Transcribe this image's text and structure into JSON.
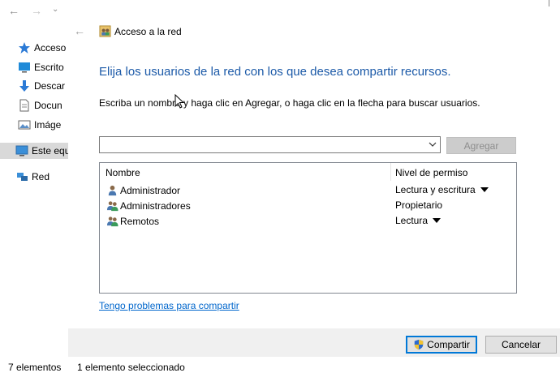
{
  "explorer": {
    "sidebar": [
      {
        "label": "Acceso",
        "icon": "star-icon"
      },
      {
        "label": "Escrito",
        "icon": "desktop-icon"
      },
      {
        "label": "Descar",
        "icon": "download-icon"
      },
      {
        "label": "Docun",
        "icon": "document-icon"
      },
      {
        "label": "Imáge",
        "icon": "pictures-icon"
      },
      {
        "label": "Este equ",
        "icon": "computer-icon"
      },
      {
        "label": "Red",
        "icon": "network-icon"
      }
    ],
    "status": {
      "count": "7 elementos",
      "selected": "1 elemento seleccionado"
    }
  },
  "dialog": {
    "title": "Acceso a la red",
    "heading": "Elija los usuarios de la red con los que desea compartir recursos.",
    "instruction": "Escriba un nombre y haga clic en Agregar, o haga clic en la flecha para buscar usuarios.",
    "user_input": {
      "value": "",
      "placeholder": ""
    },
    "add_label": "Agregar",
    "columns": {
      "name": "Nombre",
      "permission": "Nivel de permiso"
    },
    "rows": [
      {
        "name": "Administrador",
        "permission": "Lectura y escritura",
        "dropdown": true,
        "icon": "user-icon"
      },
      {
        "name": "Administradores",
        "permission": "Propietario",
        "dropdown": false,
        "icon": "group-icon"
      },
      {
        "name": "Remotos",
        "permission": "Lectura",
        "dropdown": true,
        "icon": "group-icon"
      }
    ],
    "trouble_link": "Tengo problemas para compartir",
    "share_label": "Compartir",
    "cancel_label": "Cancelar"
  }
}
